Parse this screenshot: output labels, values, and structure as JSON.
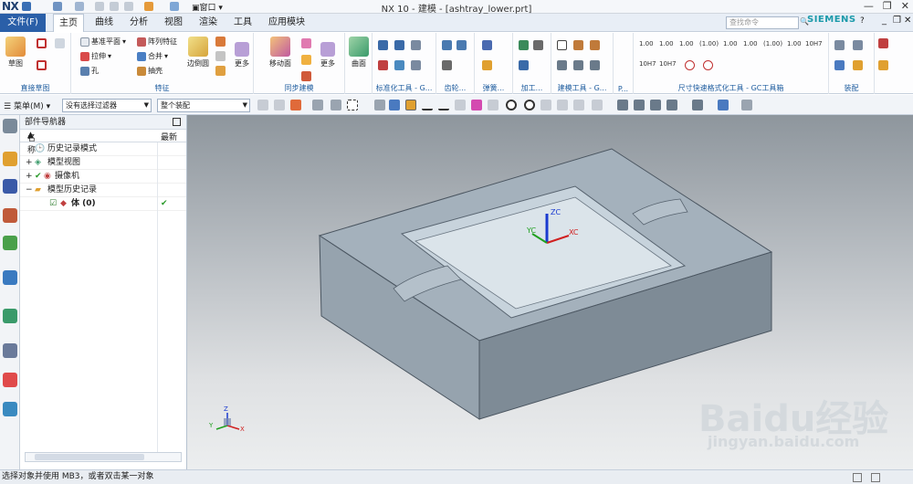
{
  "titlebar": {
    "logo": "NX",
    "title": "NX 10 - 建模 - [ashtray_lower.prt]",
    "window_menu": "窗口"
  },
  "menubar": {
    "tabs": [
      "文件(F)",
      "主页",
      "曲线",
      "分析",
      "视图",
      "渲染",
      "工具",
      "应用模块"
    ],
    "active_tab": "主页",
    "search_placeholder": "查找命令",
    "brand": "SIEMENS"
  },
  "ribbon": {
    "sketch": {
      "label": "草图",
      "group": "直接草图"
    },
    "feature": {
      "group": "特征",
      "items": [
        "基准平面",
        "阵列特征",
        "拉伸",
        "合并",
        "孔",
        "抽壳"
      ],
      "edge_blend": "边倒圆",
      "more": "更多"
    },
    "sync": {
      "group": "同步建模",
      "move_face": "移动面",
      "more": "更多"
    },
    "surface": {
      "label": "曲面"
    },
    "std_tools": {
      "group": "标准化工具 - G..."
    },
    "gear": {
      "group": "齿轮..."
    },
    "spring": {
      "group": "弹簧..."
    },
    "machining": {
      "group": "加工..."
    },
    "build_tools": {
      "group": "建模工具 - G..."
    },
    "more_group": {
      "group": "P..."
    },
    "dim_tools": {
      "group": "尺寸快速格式化工具 - GC工具箱",
      "values": [
        "1.00",
        "1.00",
        "1.00",
        "(1.00)",
        "1.00",
        "1.00",
        "(1.00)",
        "1.00",
        "10H7",
        "10H7",
        "10H7"
      ]
    },
    "assembly": {
      "group": "装配"
    }
  },
  "selectionbar": {
    "menu": "菜单(M)",
    "filter": "没有选择过滤器",
    "scope": "整个装配"
  },
  "navigator": {
    "title": "部件导航器",
    "col_name": "名称",
    "col_latest": "最新",
    "items": [
      "历史记录模式",
      "模型视图",
      "摄像机",
      "模型历史记录",
      "体 (0)"
    ]
  },
  "viewport": {
    "axis": {
      "zc": "ZC",
      "yc": "YC",
      "xc": "XC"
    },
    "triad": {
      "x": "X",
      "y": "Y",
      "z": "Z"
    },
    "watermark": {
      "brand": "Baidu经验",
      "url": "jingyan.baidu.com"
    }
  },
  "status": {
    "text": "选择对象并使用 MB3，或者双击某一对象"
  },
  "colors": {
    "accent": "#2a5fa8",
    "brand": "#1b9aaa",
    "group_label": "#1f5d9f",
    "check": "#2a9a2a"
  }
}
